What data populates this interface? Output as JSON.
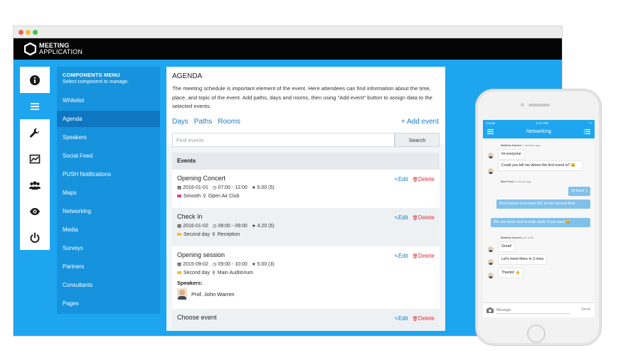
{
  "app": {
    "name_line1": "MEETING",
    "name_line2": "APPLICATION"
  },
  "rail": [
    "info-icon",
    "agenda-list-icon",
    "wrench-icon",
    "chart-icon",
    "users-icon",
    "eye-icon",
    "power-icon"
  ],
  "menu": {
    "title": "COMPONENTS MENU",
    "subtitle": "Select component to manage.",
    "items": [
      "Whitelist",
      "Agenda",
      "Speakers",
      "Social Feed",
      "PUSH Notifications",
      "Maps",
      "Networking",
      "Media",
      "Surveys",
      "Partners",
      "Consultants",
      "Pages"
    ],
    "active": "Agenda"
  },
  "agenda": {
    "title": "AGENDA",
    "description": "The meeting schedule is important element of the event. Here attendees can find information about the time, place, and topic of the event. Add paths, days and rooms, then using \"Add event\" button to assign data to the selected events.",
    "tabs": [
      "Days",
      "Paths",
      "Rooms"
    ],
    "add_event": "+ Add event",
    "search_placeholder": "Find events",
    "search_button": "Search",
    "events_header": "Events",
    "edit_label": "Edit",
    "delete_label": "Delete",
    "events": [
      {
        "title": "Opening Concert",
        "date": "2016-01-01",
        "time": "07:00 - 12:00",
        "rating": "5.00 (5)",
        "tag": "Smooth",
        "tag_color": "#e4418f",
        "place": "Open Air Club"
      },
      {
        "title": "Check In",
        "date": "2016-01-02",
        "time": "08:00 - 09:00",
        "rating": "4.20 (5)",
        "tag": "Second day",
        "tag_color": "#f5c12a",
        "place": "Reception"
      },
      {
        "title": "Opening session",
        "date": "2015-09-02",
        "time": "09:00 - 10:00",
        "rating": "5.00 (3)",
        "tag": "Second day",
        "tag_color": "#f5c12a",
        "place": "Main Auditorium",
        "speakers_label": "Speakers:",
        "speaker": "Prof. John Warren"
      },
      {
        "title": "Choose event"
      }
    ]
  },
  "phone": {
    "status_left": "Carrier",
    "status_time": "2:37 PM",
    "title": "Networking",
    "messages": [
      {
        "sender": "Mathias Kastse",
        "meta": "2 minutes ago"
      },
      {
        "text": "Hi everyone"
      },
      {
        "text": "Could you tell me where the first event is? 😀"
      },
      {
        "sender": "Max Frich",
        "meta": "1 minute ago"
      },
      {
        "text": "Hi there :)"
      },
      {
        "text": "First lecture is in room 201 on the second floor"
      },
      {
        "text": "We can meet next to main stairs if you want 😀"
      },
      {
        "sender": "Mathias Kastse",
        "meta": "just send"
      },
      {
        "text": "Great!"
      },
      {
        "text": "Let's meet there in 2 mins"
      },
      {
        "text": "Thanks! 👍"
      }
    ],
    "message_placeholder": "Message",
    "send_label": "Send"
  },
  "colors": {
    "brand_blue": "#1ea5f0",
    "menu_blue": "#1793dd",
    "menu_active": "#0f76c2",
    "delete_red": "#d9363e"
  }
}
